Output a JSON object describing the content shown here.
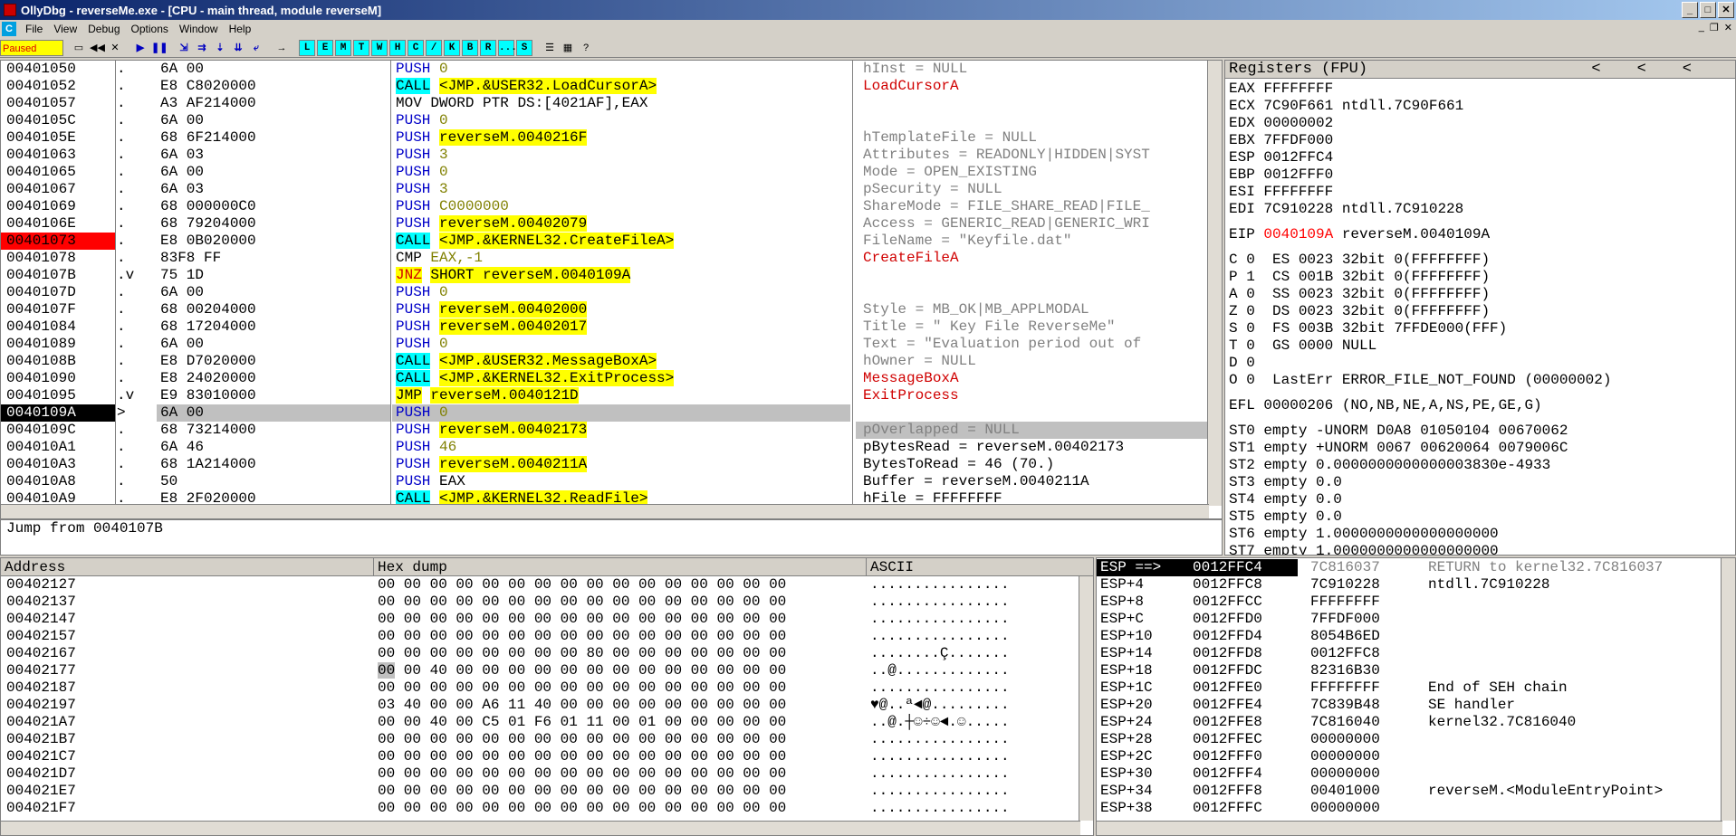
{
  "window": {
    "title": "OllyDbg - reverseMe.exe - [CPU - main thread, module reverseM]"
  },
  "menu": [
    "File",
    "View",
    "Debug",
    "Options",
    "Window",
    "Help"
  ],
  "status": "Paused",
  "toolbar_letters": [
    "L",
    "E",
    "M",
    "T",
    "W",
    "H",
    "C",
    "/",
    "K",
    "B",
    "R",
    "...",
    "S"
  ],
  "disasm": [
    {
      "addr": "00401050",
      "mk": ".",
      "hex": "6A 00",
      "op": "PUSH",
      "arg": "0",
      "cmt": "hInst = NULL",
      "cs": "gray"
    },
    {
      "addr": "00401052",
      "mk": ".",
      "hex": "E8 C8020000",
      "op": "CALL",
      "arg": "<JMP.&USER32.LoadCursorA>",
      "cmt": "LoadCursorA",
      "cs": "red"
    },
    {
      "addr": "00401057",
      "mk": ".",
      "hex": "A3 AF214000",
      "op": "MOV",
      "arg": "DWORD PTR DS:[4021AF],EAX",
      "cmt": "",
      "cs": ""
    },
    {
      "addr": "0040105C",
      "mk": ".",
      "hex": "6A 00",
      "op": "PUSH",
      "arg": "0",
      "cmt": "",
      "cs": ""
    },
    {
      "addr": "0040105E",
      "mk": ".",
      "hex": "68 6F214000",
      "op": "PUSH",
      "arg": "reverseM.0040216F",
      "cmt": "hTemplateFile = NULL",
      "cs": "gray"
    },
    {
      "addr": "00401063",
      "mk": ".",
      "hex": "6A 03",
      "op": "PUSH",
      "arg": "3",
      "cmt": "Attributes = READONLY|HIDDEN|SYST",
      "cs": "gray"
    },
    {
      "addr": "00401065",
      "mk": ".",
      "hex": "6A 00",
      "op": "PUSH",
      "arg": "0",
      "cmt": "Mode = OPEN_EXISTING",
      "cs": "gray"
    },
    {
      "addr": "00401067",
      "mk": ".",
      "hex": "6A 03",
      "op": "PUSH",
      "arg": "3",
      "cmt": "pSecurity = NULL",
      "cs": "gray"
    },
    {
      "addr": "00401069",
      "mk": ".",
      "hex": "68 000000C0",
      "op": "PUSH",
      "arg": "C0000000",
      "cmt": "ShareMode = FILE_SHARE_READ|FILE_",
      "cs": "gray"
    },
    {
      "addr": "0040106E",
      "mk": ".",
      "hex": "68 79204000",
      "op": "PUSH",
      "arg": "reverseM.00402079",
      "cmt": "Access = GENERIC_READ|GENERIC_WRI",
      "cs": "gray"
    },
    {
      "addr": "00401073",
      "mk": ".",
      "hex": "E8 0B020000",
      "op": "CALL",
      "arg": "<JMP.&KERNEL32.CreateFileA>",
      "cmt": "FileName = \"Keyfile.dat\"",
      "cs": "gray"
    },
    {
      "addr": "00401078",
      "mk": ".",
      "hex": "83F8 FF",
      "op": "CMP",
      "arg": "EAX,-1",
      "cmt": "CreateFileA",
      "cs": "red"
    },
    {
      "addr": "0040107B",
      "mk": ".v",
      "hex": "75 1D",
      "op": "JNZ",
      "arg": "SHORT reverseM.0040109A",
      "cmt": "",
      "cs": ""
    },
    {
      "addr": "0040107D",
      "mk": ".",
      "hex": "6A 00",
      "op": "PUSH",
      "arg": "0",
      "cmt": "",
      "cs": ""
    },
    {
      "addr": "0040107F",
      "mk": ".",
      "hex": "68 00204000",
      "op": "PUSH",
      "arg": "reverseM.00402000",
      "cmt": "Style = MB_OK|MB_APPLMODAL",
      "cs": "gray"
    },
    {
      "addr": "00401084",
      "mk": ".",
      "hex": "68 17204000",
      "op": "PUSH",
      "arg": "reverseM.00402017",
      "cmt": "Title = \" Key File ReverseMe\"",
      "cs": "gray"
    },
    {
      "addr": "00401089",
      "mk": ".",
      "hex": "6A 00",
      "op": "PUSH",
      "arg": "0",
      "cmt": "Text = \"Evaluation period out of",
      "cs": "gray"
    },
    {
      "addr": "0040108B",
      "mk": ".",
      "hex": "E8 D7020000",
      "op": "CALL",
      "arg": "<JMP.&USER32.MessageBoxA>",
      "cmt": "hOwner = NULL",
      "cs": "gray"
    },
    {
      "addr": "00401090",
      "mk": ".",
      "hex": "E8 24020000",
      "op": "CALL",
      "arg": "<JMP.&KERNEL32.ExitProcess>",
      "cmt": "MessageBoxA",
      "cs": "red"
    },
    {
      "addr": "00401095",
      "mk": ".v",
      "hex": "E9 83010000",
      "op": "JMP",
      "arg": "reverseM.0040121D",
      "cmt": "ExitProcess",
      "cs": "red"
    },
    {
      "addr": "0040109A",
      "mk": ">",
      "hex": "6A 00",
      "op": "PUSH",
      "arg": "0",
      "cmt": "",
      "cs": ""
    },
    {
      "addr": "0040109C",
      "mk": ".",
      "hex": "68 73214000",
      "op": "PUSH",
      "arg": "reverseM.00402173",
      "cmt": "pOverlapped = NULL",
      "cs": "gray"
    },
    {
      "addr": "004010A1",
      "mk": ".",
      "hex": "6A 46",
      "op": "PUSH",
      "arg": "46",
      "cmt": "pBytesRead = reverseM.00402173",
      "cs": ""
    },
    {
      "addr": "004010A3",
      "mk": ".",
      "hex": "68 1A214000",
      "op": "PUSH",
      "arg": "reverseM.0040211A",
      "cmt": "BytesToRead = 46 (70.)",
      "cs": ""
    },
    {
      "addr": "004010A8",
      "mk": ".",
      "hex": "50",
      "op": "PUSH",
      "arg": "EAX",
      "cmt": "Buffer = reverseM.0040211A",
      "cs": ""
    },
    {
      "addr": "004010A9",
      "mk": ".",
      "hex": "E8 2F020000",
      "op": "CALL",
      "arg": "<JMP.&KERNEL32.ReadFile>",
      "cmt": "hFile = FFFFFFFF",
      "cs": ""
    }
  ],
  "info_line": "Jump from 0040107B",
  "registers": {
    "title": "Registers (FPU)",
    "lines": [
      "EAX FFFFFFFF",
      "ECX 7C90F661 ntdll.7C90F661",
      "EDX 00000002",
      "EBX 7FFDF000",
      "ESP 0012FFC4",
      "EBP 0012FFF0",
      "ESI FFFFFFFF",
      "EDI 7C910228 ntdll.7C910228",
      "",
      "EIP 0040109A reverseM.0040109A",
      "",
      "C 0  ES 0023 32bit 0(FFFFFFFF)",
      "P 1  CS 001B 32bit 0(FFFFFFFF)",
      "A 0  SS 0023 32bit 0(FFFFFFFF)",
      "Z 0  DS 0023 32bit 0(FFFFFFFF)",
      "S 0  FS 003B 32bit 7FFDE000(FFF)",
      "T 0  GS 0000 NULL",
      "D 0",
      "O 0  LastErr ERROR_FILE_NOT_FOUND (00000002)",
      "",
      "EFL 00000206 (NO,NB,NE,A,NS,PE,GE,G)",
      "",
      "ST0 empty -UNORM D0A8 01050104 00670062",
      "ST1 empty +UNORM 0067 00620064 0079006C",
      "ST2 empty 0.0000000000000003830e-4933",
      "ST3 empty 0.0",
      "ST4 empty 0.0",
      "ST5 empty 0.0",
      "ST6 empty 1.0000000000000000000",
      "ST7 empty 1.0000000000000000000"
    ]
  },
  "dump": {
    "headers": [
      "Address",
      "Hex dump",
      "ASCII"
    ],
    "rows": [
      {
        "addr": "00402127",
        "hex": "00 00 00 00 00 00 00 00 00 00 00 00 00 00 00 00",
        "ascii": "................"
      },
      {
        "addr": "00402137",
        "hex": "00 00 00 00 00 00 00 00 00 00 00 00 00 00 00 00",
        "ascii": "................"
      },
      {
        "addr": "00402147",
        "hex": "00 00 00 00 00 00 00 00 00 00 00 00 00 00 00 00",
        "ascii": "................"
      },
      {
        "addr": "00402157",
        "hex": "00 00 00 00 00 00 00 00 00 00 00 00 00 00 00 00",
        "ascii": "................"
      },
      {
        "addr": "00402167",
        "hex": "00 00 00 00 00 00 00 00 80 00 00 00 00 00 00 00",
        "ascii": "........Ç......."
      },
      {
        "addr": "00402177",
        "hex": "00 00 40 00 00 00 00 00 00 00 00 00 00 00 00 00",
        "ascii": "..@............."
      },
      {
        "addr": "00402187",
        "hex": "00 00 00 00 00 00 00 00 00 00 00 00 00 00 00 00",
        "ascii": "................"
      },
      {
        "addr": "00402197",
        "hex": "03 40 00 00 A6 11 40 00 00 00 00 00 00 00 00 00",
        "ascii": "♥@..ª◄@........."
      },
      {
        "addr": "004021A7",
        "hex": "00 00 40 00 C5 01 F6 01 11 00 01 00 00 00 00 00",
        "ascii": "..@.┼☺÷☺◄.☺....."
      },
      {
        "addr": "004021B7",
        "hex": "00 00 00 00 00 00 00 00 00 00 00 00 00 00 00 00",
        "ascii": "................"
      },
      {
        "addr": "004021C7",
        "hex": "00 00 00 00 00 00 00 00 00 00 00 00 00 00 00 00",
        "ascii": "................"
      },
      {
        "addr": "004021D7",
        "hex": "00 00 00 00 00 00 00 00 00 00 00 00 00 00 00 00",
        "ascii": "................"
      },
      {
        "addr": "004021E7",
        "hex": "00 00 00 00 00 00 00 00 00 00 00 00 00 00 00 00",
        "ascii": "................"
      },
      {
        "addr": "004021F7",
        "hex": "00 00 00 00 00 00 00 00 00 00 00 00 00 00 00 00",
        "ascii": "................"
      }
    ]
  },
  "stack": [
    {
      "off": "ESP ==>",
      "addr": "0012FFC4",
      "val": "7C816037",
      "cmt": "RETURN to kernel32.7C816037"
    },
    {
      "off": "ESP+4",
      "addr": "0012FFC8",
      "val": "7C910228",
      "cmt": "ntdll.7C910228"
    },
    {
      "off": "ESP+8",
      "addr": "0012FFCC",
      "val": "FFFFFFFF",
      "cmt": ""
    },
    {
      "off": "ESP+C",
      "addr": "0012FFD0",
      "val": "7FFDF000",
      "cmt": ""
    },
    {
      "off": "ESP+10",
      "addr": "0012FFD4",
      "val": "8054B6ED",
      "cmt": ""
    },
    {
      "off": "ESP+14",
      "addr": "0012FFD8",
      "val": "0012FFC8",
      "cmt": ""
    },
    {
      "off": "ESP+18",
      "addr": "0012FFDC",
      "val": "82316B30",
      "cmt": ""
    },
    {
      "off": "ESP+1C",
      "addr": "0012FFE0",
      "val": "FFFFFFFF",
      "cmt": "End of SEH chain"
    },
    {
      "off": "ESP+20",
      "addr": "0012FFE4",
      "val": "7C839B48",
      "cmt": "SE handler"
    },
    {
      "off": "ESP+24",
      "addr": "0012FFE8",
      "val": "7C816040",
      "cmt": "kernel32.7C816040"
    },
    {
      "off": "ESP+28",
      "addr": "0012FFEC",
      "val": "00000000",
      "cmt": ""
    },
    {
      "off": "ESP+2C",
      "addr": "0012FFF0",
      "val": "00000000",
      "cmt": ""
    },
    {
      "off": "ESP+30",
      "addr": "0012FFF4",
      "val": "00000000",
      "cmt": ""
    },
    {
      "off": "ESP+34",
      "addr": "0012FFF8",
      "val": "00401000",
      "cmt": "reverseM.<ModuleEntryPoint>"
    },
    {
      "off": "ESP+38",
      "addr": "0012FFFC",
      "val": "00000000",
      "cmt": ""
    }
  ]
}
